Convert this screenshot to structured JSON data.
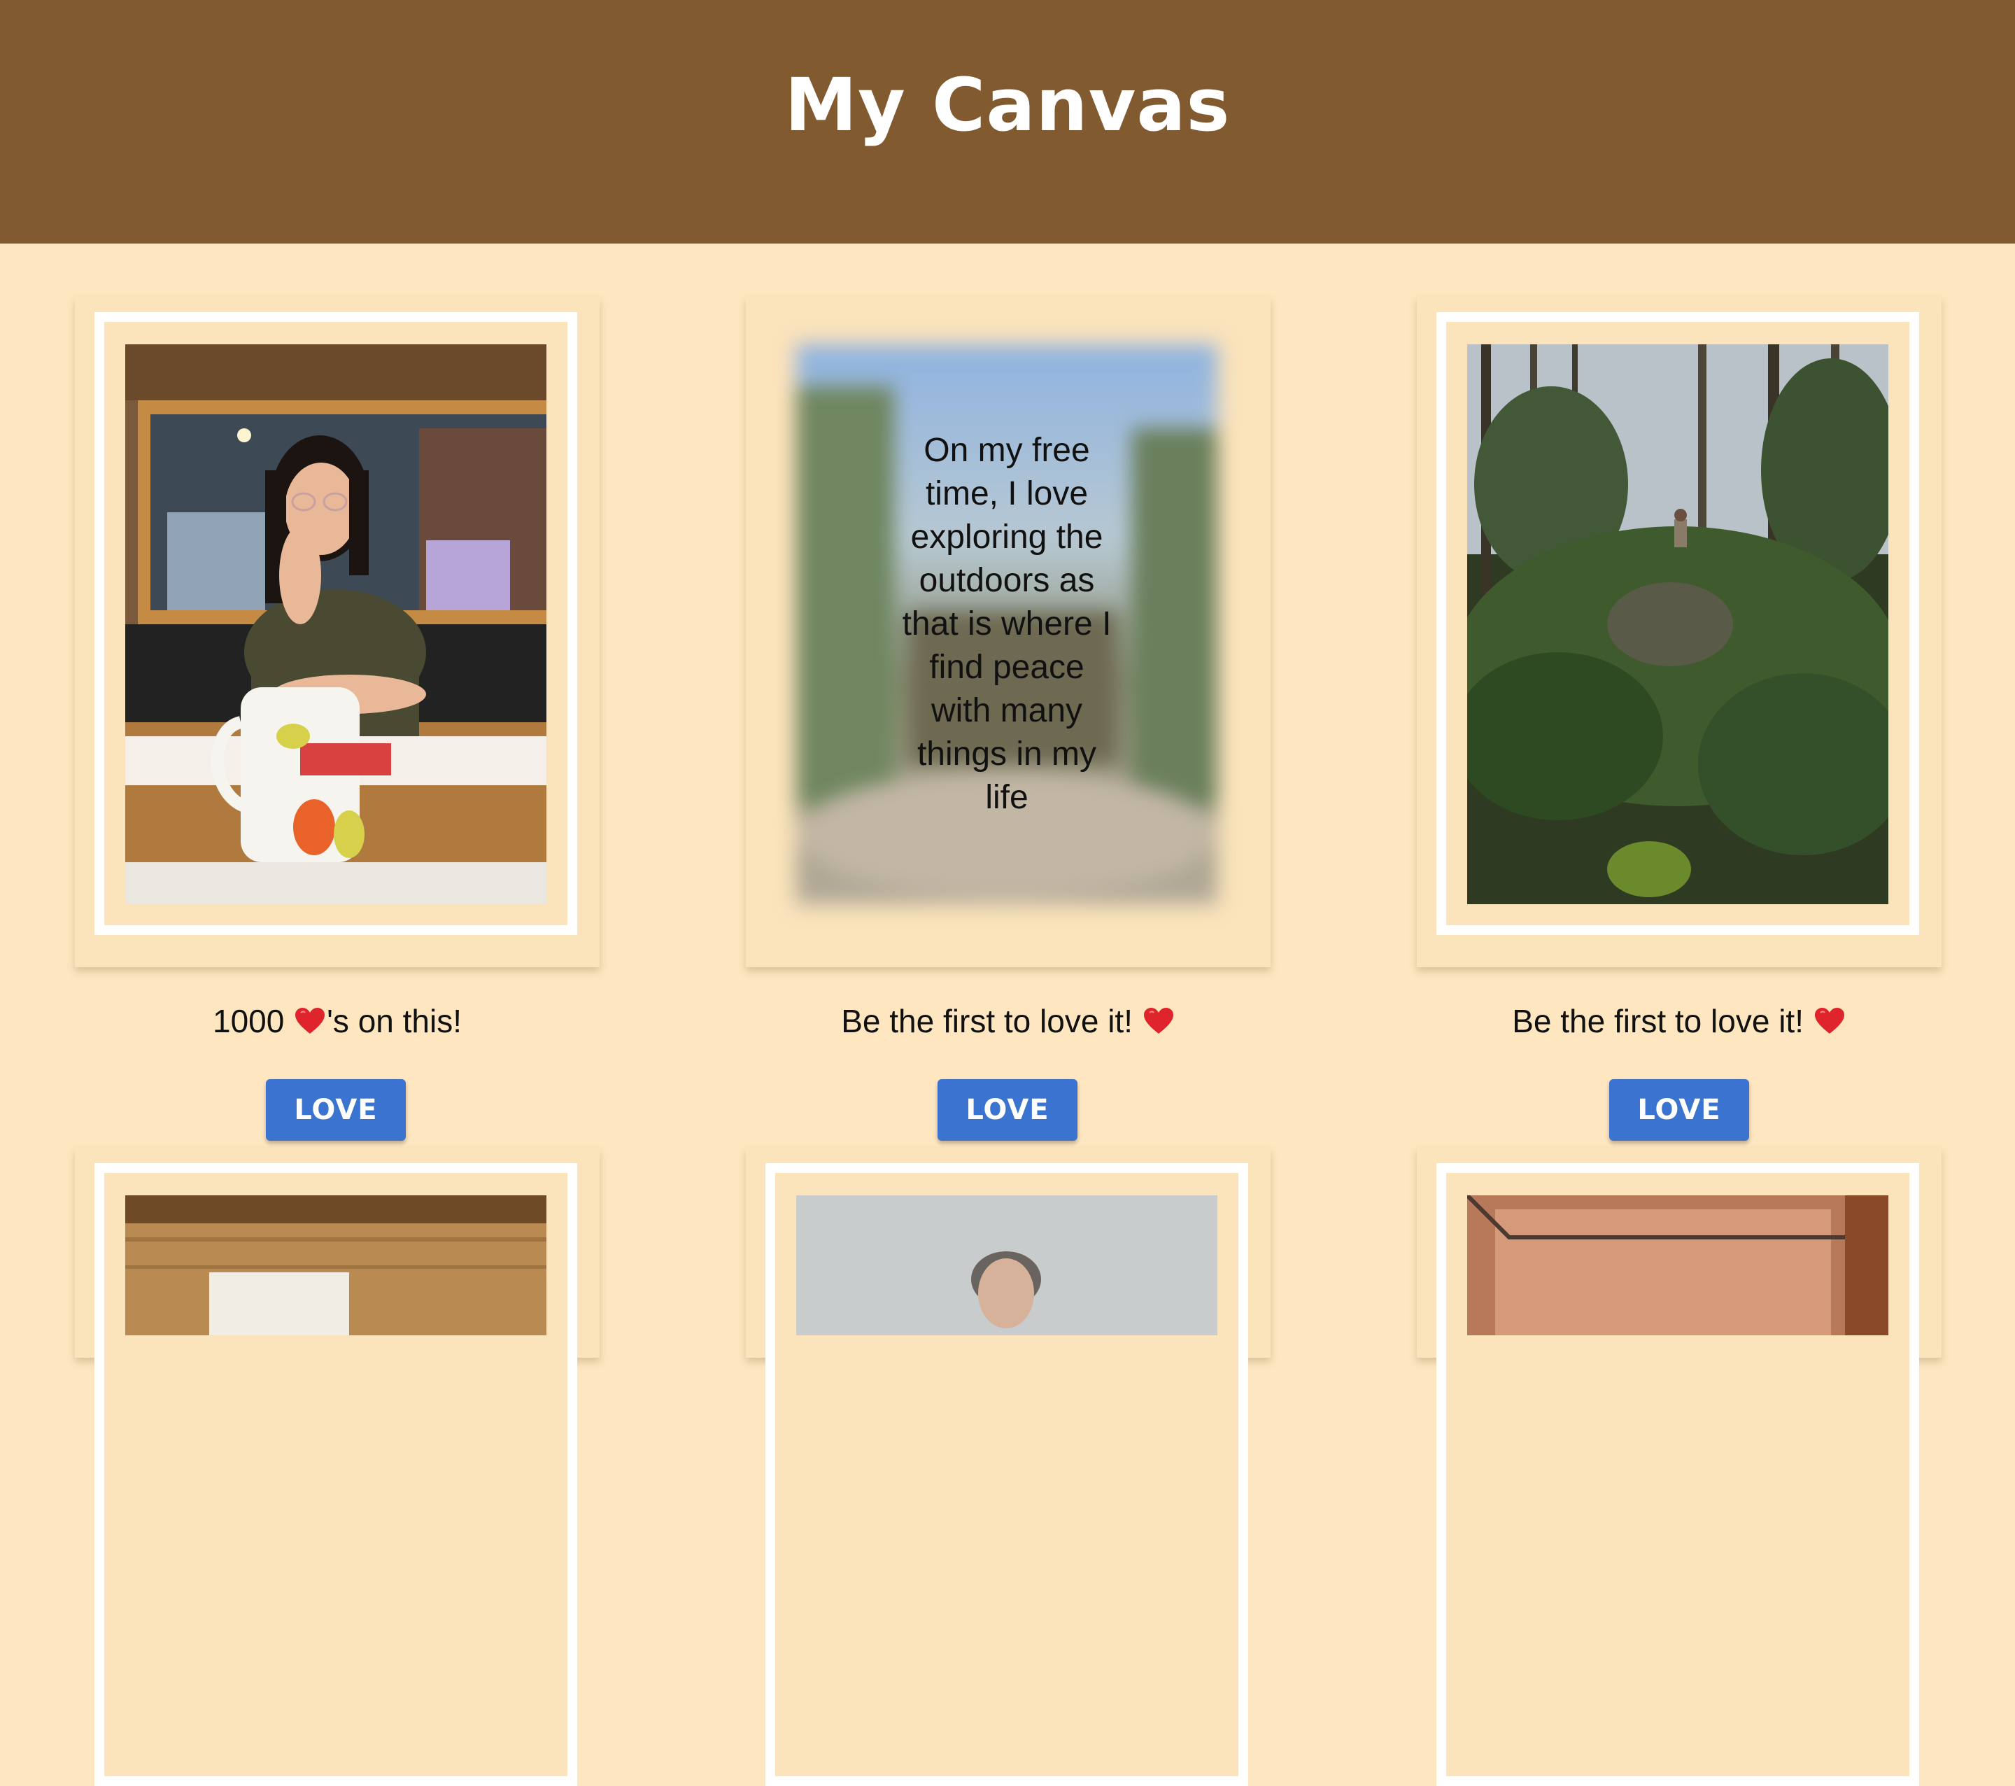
{
  "header": {
    "title": "My Canvas"
  },
  "cards": [
    {
      "caption_prefix": "1000",
      "caption_suffix": "'s on this!",
      "button_label": "LOVE"
    },
    {
      "caption_prefix": "Be the first to love it!",
      "caption_suffix": "",
      "button_label": "LOVE",
      "hover_text": "On my free time, I love exploring the outdoors as that is where I find peace with many things in my life"
    },
    {
      "caption_prefix": "Be the first to love it!",
      "caption_suffix": "",
      "button_label": "LOVE"
    }
  ],
  "colors": {
    "header_bg": "#815a2f",
    "page_bg": "#fde6c0",
    "button_bg": "#3b74d0",
    "heart": "#e0242b"
  },
  "icons": {
    "heart": "heart-icon"
  }
}
